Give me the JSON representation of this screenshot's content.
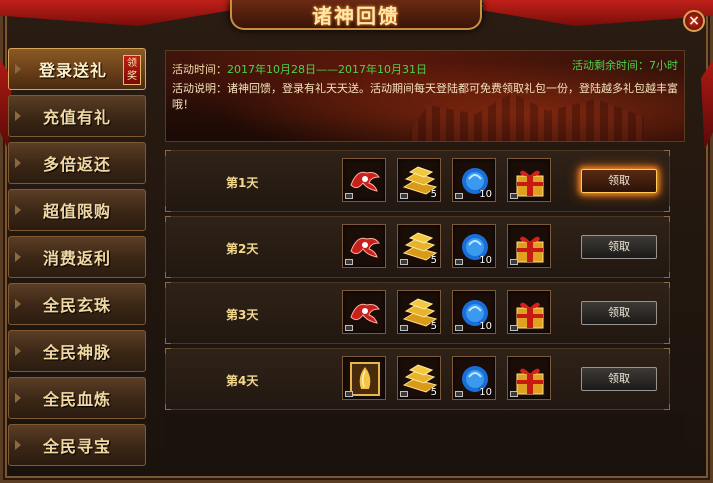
{
  "window": {
    "title": "诸神回馈",
    "close_glyph": "×"
  },
  "sidebar": {
    "items": [
      {
        "label": "登录送礼",
        "active": true,
        "badge": "领奖"
      },
      {
        "label": "充值有礼"
      },
      {
        "label": "多倍返还"
      },
      {
        "label": "超值限购"
      },
      {
        "label": "消费返利"
      },
      {
        "label": "全民玄珠"
      },
      {
        "label": "全民神脉"
      },
      {
        "label": "全民血炼"
      },
      {
        "label": "全民寻宝"
      }
    ]
  },
  "info": {
    "time_label": "活动时间：",
    "time_value": "2017年10月28日——2017年10月31日",
    "remain": "活动剩余时间：7小时",
    "desc": "活动说明：诸神回馈，登录有礼天天送。活动期间每天登陆都可免费领取礼包一份，登陆越多礼包越丰富哦！"
  },
  "rows": [
    {
      "day": "第1天",
      "claim": "领取",
      "highlight": true,
      "items": [
        {
          "icon": "red-wings-icon",
          "count": ""
        },
        {
          "icon": "gold-bars-icon",
          "count": "5"
        },
        {
          "icon": "blue-orb-icon",
          "count": "10"
        },
        {
          "icon": "gift-box-icon",
          "count": ""
        }
      ]
    },
    {
      "day": "第2天",
      "claim": "领取",
      "highlight": false,
      "items": [
        {
          "icon": "red-wings-icon",
          "count": ""
        },
        {
          "icon": "gold-bars-icon",
          "count": "5"
        },
        {
          "icon": "blue-orb-icon",
          "count": "10"
        },
        {
          "icon": "gift-box-icon",
          "count": ""
        }
      ]
    },
    {
      "day": "第3天",
      "claim": "领取",
      "highlight": false,
      "items": [
        {
          "icon": "red-wings-icon",
          "count": ""
        },
        {
          "icon": "gold-bars-icon",
          "count": "5"
        },
        {
          "icon": "blue-orb-icon",
          "count": "10"
        },
        {
          "icon": "gift-box-icon",
          "count": ""
        }
      ]
    },
    {
      "day": "第4天",
      "claim": "领取",
      "highlight": false,
      "items": [
        {
          "icon": "golden-scroll-icon",
          "count": ""
        },
        {
          "icon": "gold-bars-icon",
          "count": "5"
        },
        {
          "icon": "blue-orb-icon",
          "count": "10"
        },
        {
          "icon": "gift-box-icon",
          "count": ""
        }
      ]
    }
  ]
}
